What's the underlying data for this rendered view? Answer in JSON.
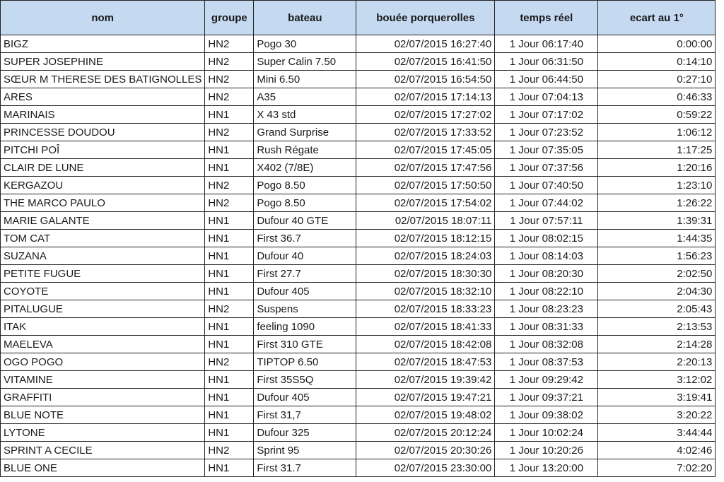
{
  "headers": {
    "nom": "nom",
    "groupe": "groupe",
    "bateau": "bateau",
    "bouee": "bouée porquerolles",
    "temps": "temps réel",
    "ecart": "ecart au 1°"
  },
  "rows": [
    {
      "nom": "BIGZ",
      "groupe": "HN2",
      "bateau": "Pogo 30",
      "bouee": "02/07/2015 16:27:40",
      "temps": "1 Jour 06:17:40",
      "ecart": "0:00:00"
    },
    {
      "nom": "SUPER JOSEPHINE",
      "groupe": "HN2",
      "bateau": "Super Calin 7.50",
      "bouee": "02/07/2015 16:41:50",
      "temps": "1 Jour 06:31:50",
      "ecart": "0:14:10"
    },
    {
      "nom": "SŒUR M THERESE DES BATIGNOLLES",
      "groupe": "HN2",
      "bateau": "Mini 6.50",
      "bouee": "02/07/2015 16:54:50",
      "temps": "1 Jour 06:44:50",
      "ecart": "0:27:10"
    },
    {
      "nom": "ARES",
      "groupe": "HN2",
      "bateau": "A35",
      "bouee": "02/07/2015 17:14:13",
      "temps": "1 Jour 07:04:13",
      "ecart": "0:46:33"
    },
    {
      "nom": "MARINAIS",
      "groupe": "HN1",
      "bateau": "X 43 std",
      "bouee": "02/07/2015 17:27:02",
      "temps": "1 Jour 07:17:02",
      "ecart": "0:59:22"
    },
    {
      "nom": "PRINCESSE DOUDOU",
      "groupe": "HN2",
      "bateau": "Grand Surprise",
      "bouee": "02/07/2015 17:33:52",
      "temps": "1 Jour 07:23:52",
      "ecart": "1:06:12"
    },
    {
      "nom": "PITCHI POÎ",
      "groupe": "HN1",
      "bateau": "Rush Régate",
      "bouee": "02/07/2015 17:45:05",
      "temps": "1 Jour 07:35:05",
      "ecart": "1:17:25"
    },
    {
      "nom": "CLAIR DE LUNE",
      "groupe": "HN1",
      "bateau": "X402 (7/8E)",
      "bouee": "02/07/2015 17:47:56",
      "temps": "1 Jour 07:37:56",
      "ecart": "1:20:16"
    },
    {
      "nom": "KERGAZOU",
      "groupe": "HN2",
      "bateau": "Pogo 8.50",
      "bouee": "02/07/2015 17:50:50",
      "temps": "1 Jour 07:40:50",
      "ecart": "1:23:10"
    },
    {
      "nom": "THE MARCO PAULO",
      "groupe": "HN2",
      "bateau": "Pogo 8.50",
      "bouee": "02/07/2015 17:54:02",
      "temps": "1 Jour 07:44:02",
      "ecart": "1:26:22"
    },
    {
      "nom": "MARIE GALANTE",
      "groupe": "HN1",
      "bateau": "Dufour 40 GTE",
      "bouee": "02/07/2015 18:07:11",
      "temps": "1 Jour 07:57:11",
      "ecart": "1:39:31"
    },
    {
      "nom": "TOM CAT",
      "groupe": "HN1",
      "bateau": "First 36.7",
      "bouee": "02/07/2015 18:12:15",
      "temps": "1 Jour 08:02:15",
      "ecart": "1:44:35"
    },
    {
      "nom": "SUZANA",
      "groupe": "HN1",
      "bateau": "Dufour 40",
      "bouee": "02/07/2015 18:24:03",
      "temps": "1 Jour 08:14:03",
      "ecart": "1:56:23"
    },
    {
      "nom": "PETITE FUGUE",
      "groupe": "HN1",
      "bateau": "First 27.7",
      "bouee": "02/07/2015 18:30:30",
      "temps": "1 Jour 08:20:30",
      "ecart": "2:02:50"
    },
    {
      "nom": "COYOTE",
      "groupe": "HN1",
      "bateau": "Dufour 405",
      "bouee": "02/07/2015 18:32:10",
      "temps": "1 Jour 08:22:10",
      "ecart": "2:04:30"
    },
    {
      "nom": "PITALUGUE",
      "groupe": "HN2",
      "bateau": "Suspens",
      "bouee": "02/07/2015 18:33:23",
      "temps": "1 Jour 08:23:23",
      "ecart": "2:05:43"
    },
    {
      "nom": "ITAK",
      "groupe": "HN1",
      "bateau": "feeling 1090",
      "bouee": "02/07/2015 18:41:33",
      "temps": "1 Jour 08:31:33",
      "ecart": "2:13:53"
    },
    {
      "nom": "MAELEVA",
      "groupe": "HN1",
      "bateau": "First 310 GTE",
      "bouee": "02/07/2015 18:42:08",
      "temps": "1 Jour 08:32:08",
      "ecart": "2:14:28"
    },
    {
      "nom": "OGO POGO",
      "groupe": "HN2",
      "bateau": "TIPTOP 6.50",
      "bouee": "02/07/2015 18:47:53",
      "temps": "1 Jour 08:37:53",
      "ecart": "2:20:13"
    },
    {
      "nom": "VITAMINE",
      "groupe": "HN1",
      "bateau": "First 35S5Q",
      "bouee": "02/07/2015 19:39:42",
      "temps": "1 Jour 09:29:42",
      "ecart": "3:12:02"
    },
    {
      "nom": "GRAFFITI",
      "groupe": "HN1",
      "bateau": "Dufour 405",
      "bouee": "02/07/2015 19:47:21",
      "temps": "1 Jour 09:37:21",
      "ecart": "3:19:41"
    },
    {
      "nom": "BLUE NOTE",
      "groupe": "HN1",
      "bateau": "First 31,7",
      "bouee": "02/07/2015 19:48:02",
      "temps": "1 Jour 09:38:02",
      "ecart": "3:20:22"
    },
    {
      "nom": "LYTONE",
      "groupe": "HN1",
      "bateau": "Dufour 325",
      "bouee": "02/07/2015 20:12:24",
      "temps": "1 Jour 10:02:24",
      "ecart": "3:44:44"
    },
    {
      "nom": "SPRINT A CECILE",
      "groupe": "HN2",
      "bateau": "Sprint 95",
      "bouee": "02/07/2015 20:30:26",
      "temps": "1 Jour 10:20:26",
      "ecart": "4:02:46"
    },
    {
      "nom": "BLUE ONE",
      "groupe": "HN1",
      "bateau": "First 31.7",
      "bouee": "02/07/2015 23:30:00",
      "temps": "1 Jour 13:20:00",
      "ecart": "7:02:20"
    }
  ]
}
